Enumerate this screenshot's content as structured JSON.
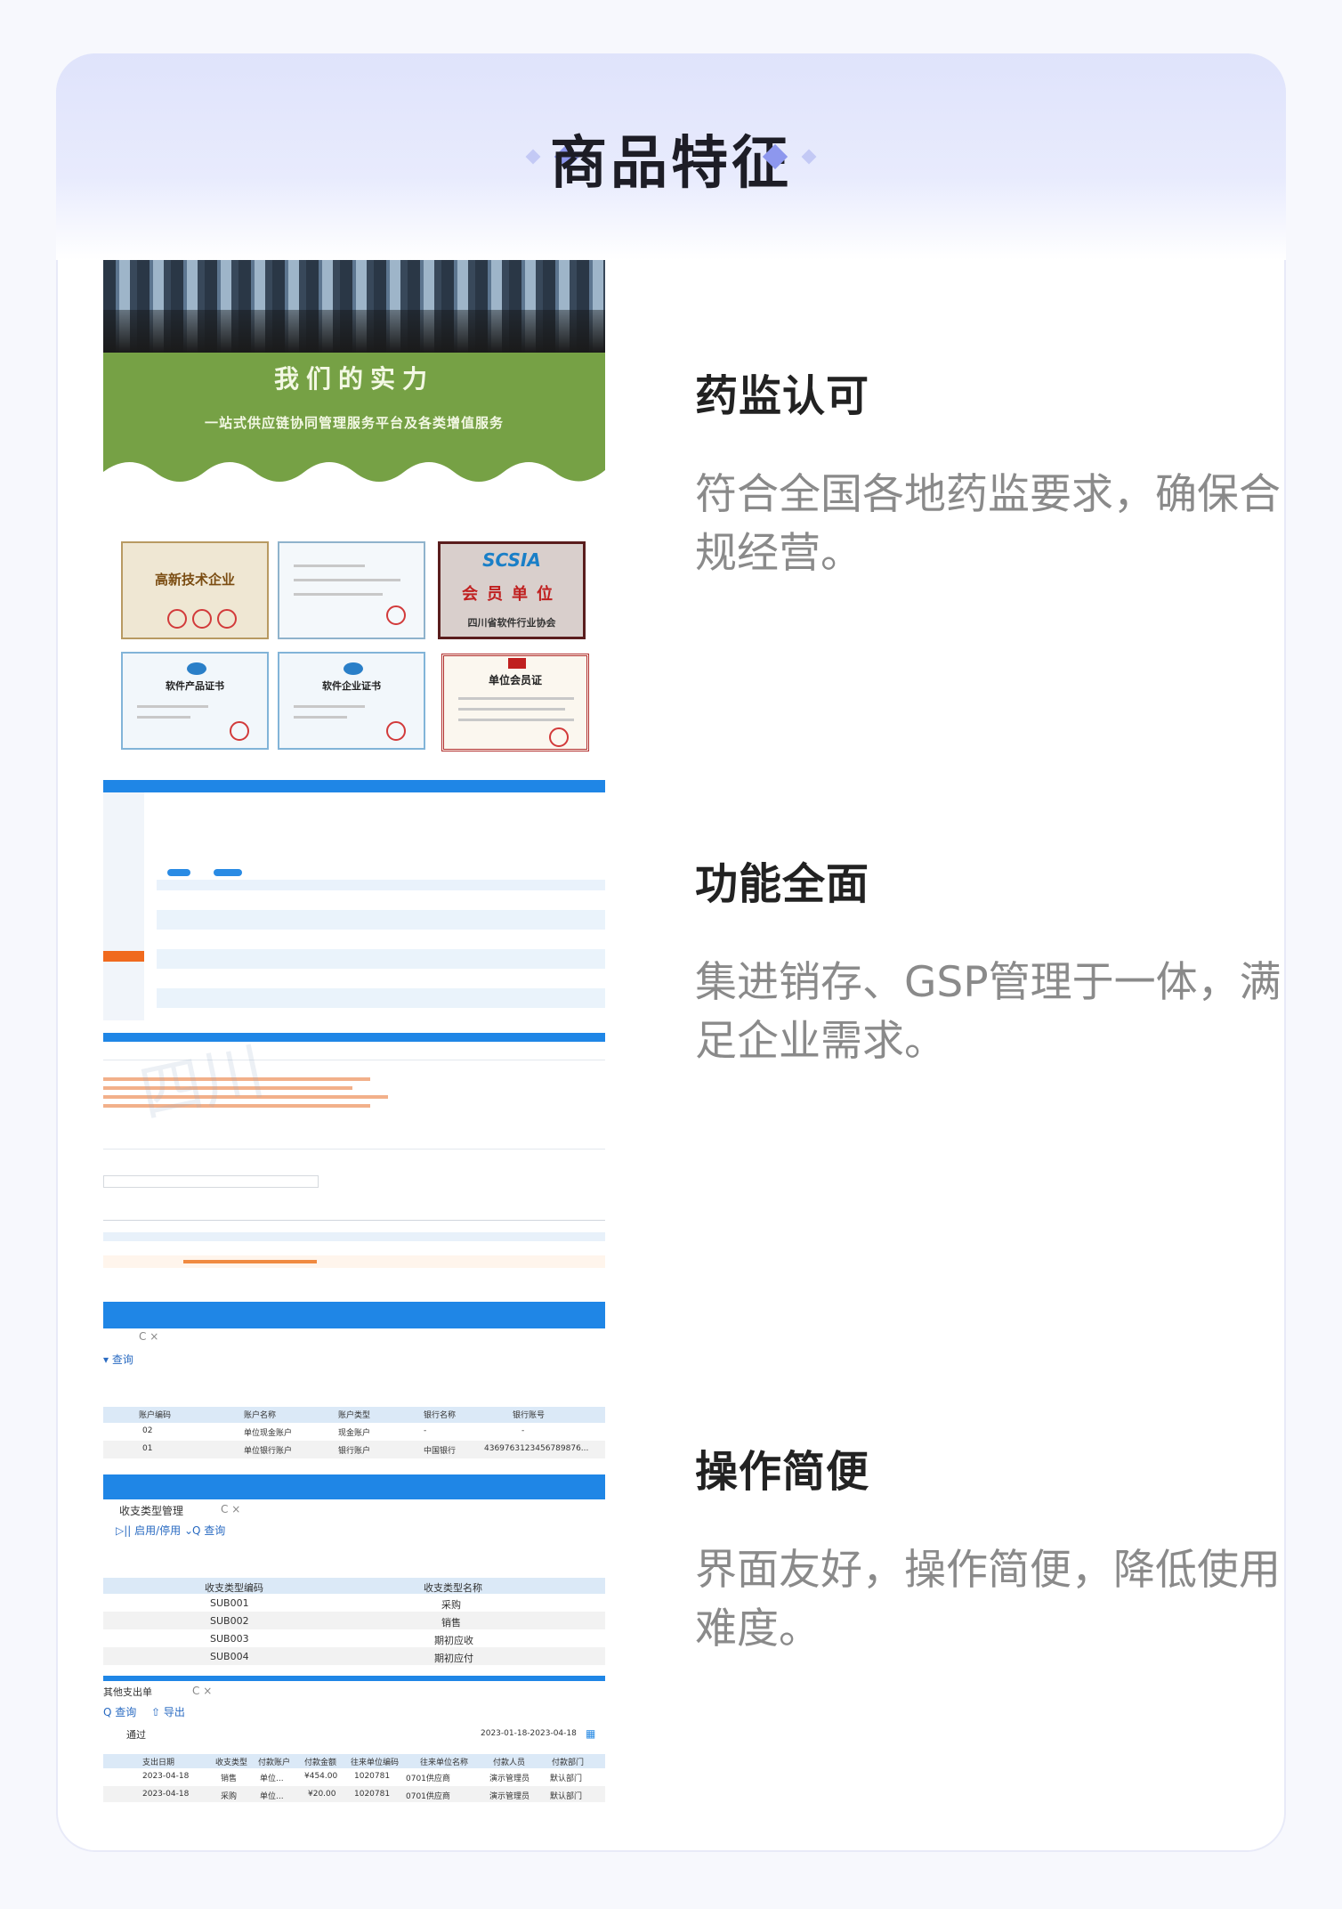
{
  "header": {
    "title": "商品特征"
  },
  "promo": {
    "headline": "我们的实力",
    "subline": "一站式供应链协同管理服务平台及各类增值服务",
    "certificates": [
      {
        "label": "高新技术企业"
      },
      {
        "label": ""
      },
      {
        "label": "会员单位"
      },
      {
        "label": "软件产品证书"
      },
      {
        "label": "软件企业证书"
      },
      {
        "label": "单位会员证"
      }
    ],
    "cert_extra": {
      "scsia": "SCSIA",
      "org": "四川省软件行业协会"
    }
  },
  "features": [
    {
      "title": "药监认可",
      "desc": "符合全国各地药监要求，确保合规经营。"
    },
    {
      "title": "功能全面",
      "desc": "集进销存、GSP管理于一体，满足企业需求。"
    },
    {
      "title": "操作简便",
      "desc": "界面友好，操作简便，降低使用难度。"
    }
  ],
  "screens": {
    "accounts": {
      "headers": [
        "账户编码",
        "账户名称",
        "账户类型",
        "银行名称",
        "银行账号"
      ],
      "rows": [
        [
          "02",
          "单位现金账户",
          "现金账户",
          "-",
          "-"
        ],
        [
          "01",
          "单位银行账户",
          "银行账户",
          "中国银行",
          "4369763123456789876..."
        ]
      ],
      "search": "查询"
    },
    "income_types": {
      "tab": "收支类型管理",
      "toolbar": "启用/停用",
      "search": "查询",
      "headers": [
        "收支类型编码",
        "收支类型名称"
      ],
      "rows": [
        [
          "SUB001",
          "采购"
        ],
        [
          "SUB002",
          "销售"
        ],
        [
          "SUB003",
          "期初应收"
        ],
        [
          "SUB004",
          "期初应付"
        ]
      ]
    },
    "expense": {
      "tab": "其他支出单",
      "search": "查询",
      "export": "导出",
      "pass": "通过",
      "date_range": "2023-01-18-2023-04-18",
      "headers": [
        "支出日期",
        "收支类型",
        "付款账户",
        "付款金额",
        "往来单位编码",
        "往来单位名称",
        "付款人员",
        "付款部门"
      ],
      "rows": [
        [
          "2023-04-18",
          "销售",
          "单位...",
          "¥454.00",
          "1020781",
          "0701供应商",
          "演示管理员",
          "默认部门"
        ],
        [
          "2023-04-18",
          "采购",
          "单位...",
          "¥20.00",
          "1020781",
          "0701供应商",
          "演示管理员",
          "默认部门"
        ]
      ]
    }
  },
  "colors": {
    "accent": "#8d97ee",
    "app_blue": "#1f86e6",
    "promo_green": "#76a145"
  }
}
